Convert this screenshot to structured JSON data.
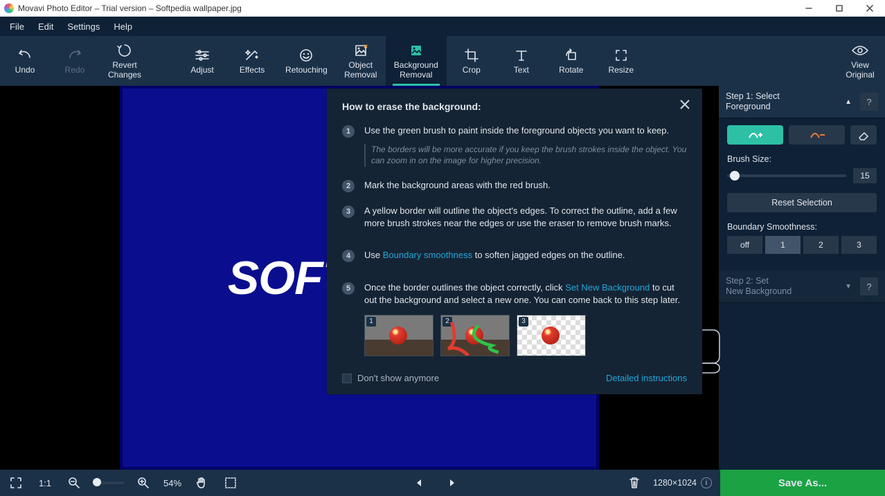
{
  "window": {
    "title": "Movavi Photo Editor – Trial version – Softpedia wallpaper.jpg"
  },
  "menubar": {
    "file": "File",
    "edit": "Edit",
    "settings": "Settings",
    "help": "Help"
  },
  "toolbar": {
    "undo": "Undo",
    "redo": "Redo",
    "revert": "Revert\nChanges",
    "adjust": "Adjust",
    "effects": "Effects",
    "retouching": "Retouching",
    "object_removal": "Object\nRemoval",
    "background_removal": "Background\nRemoval",
    "crop": "Crop",
    "text": "Text",
    "rotate": "Rotate",
    "resize": "Resize",
    "view_original": "View\nOriginal"
  },
  "canvas": {
    "watermark": "SOFTPEDIA",
    "watermark_symbol": "®"
  },
  "popup": {
    "title": "How to erase the background:",
    "step1": "Use the green brush to paint inside the foreground objects you want to keep.",
    "step1_hint": "The borders will be more accurate if you keep the brush strokes inside the object. You can zoom in on the image for higher precision.",
    "step2": "Mark the background areas with the red brush.",
    "step3": "A yellow border will outline the object's edges. To correct the outline, add a few more brush strokes near the edges or use the eraser to remove brush marks.",
    "step4_pre": "Use ",
    "step4_link": "Boundary smoothness",
    "step4_post": " to soften jagged edges on the outline.",
    "step5_pre": "Once the border outlines the object correctly, click ",
    "step5_link": "Set New Background",
    "step5_post": " to cut out the background and select a new one. You can come back to this step later.",
    "thumbs": [
      "1",
      "2",
      "3"
    ],
    "dont_show": "Don't show anymore",
    "detailed": "Detailed instructions"
  },
  "rightpanel": {
    "step1_title": "Step 1: Select\nForeground",
    "brush_size_label": "Brush Size:",
    "brush_size_value": "15",
    "reset_selection": "Reset Selection",
    "boundary_label": "Boundary Smoothness:",
    "segments": [
      "off",
      "1",
      "2",
      "3"
    ],
    "step2_title": "Step 2: Set\nNew Background"
  },
  "statusbar": {
    "onetoone": "1:1",
    "zoom_pct": "54%",
    "dimensions": "1280×1024",
    "save_as": "Save As..."
  }
}
